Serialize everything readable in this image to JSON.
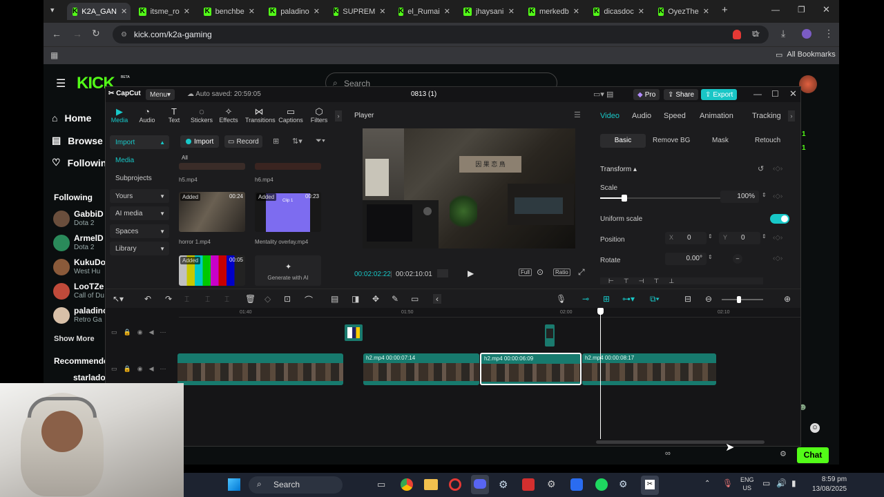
{
  "browser": {
    "tabs": [
      {
        "label": "K2A_GAN",
        "active": true
      },
      {
        "label": "itsme_ro"
      },
      {
        "label": "benchbe"
      },
      {
        "label": "paladino"
      },
      {
        "label": "SUPREM"
      },
      {
        "label": "el_Rumai"
      },
      {
        "label": "jhaysani"
      },
      {
        "label": "merkedb"
      },
      {
        "label": "dicasdoc"
      },
      {
        "label": "OyezThe"
      }
    ],
    "url": "kick.com/k2a-gaming",
    "all_bookmarks": "All Bookmarks"
  },
  "kick": {
    "search_placeholder": "Search",
    "beta": "BETA",
    "nav": [
      {
        "label": "Home"
      },
      {
        "label": "Browse"
      },
      {
        "label": "Following"
      }
    ],
    "following_header": "Following",
    "following": [
      {
        "name": "GabbiD",
        "game": "Dota 2"
      },
      {
        "name": "ArmelD",
        "game": "Dota 2"
      },
      {
        "name": "KukuDo",
        "game": "West Hu"
      },
      {
        "name": "LooTZe",
        "game": "Call of Du"
      },
      {
        "name": "paladino",
        "game": "Retro Ga"
      }
    ],
    "show_more": "Show More",
    "recommended": "Recommended",
    "recommended_first": "starlado",
    "chat_button": "Chat",
    "right_counts": [
      "1",
      "1"
    ]
  },
  "capcut": {
    "logo": "CapCut",
    "menu": "Menu",
    "autosave": "Auto saved: 20:59:05",
    "project": "0813 (1)",
    "pro": "Pro",
    "share": "Share",
    "export": "Export",
    "tools": [
      "Media",
      "Audio",
      "Text",
      "Stickers",
      "Effects",
      "Transitions",
      "Captions",
      "Filters"
    ],
    "media_side": [
      {
        "label": "Import"
      },
      {
        "label": "Media"
      },
      {
        "label": "Subprojects"
      },
      {
        "label": "Yours"
      },
      {
        "label": "AI media"
      },
      {
        "label": "Spaces"
      },
      {
        "label": "Library"
      }
    ],
    "import_btn": "Import",
    "record_btn": "Record",
    "all_label": "All",
    "media_items": [
      {
        "name": "h5.mp4"
      },
      {
        "name": "h6.mp4"
      },
      {
        "name": "horror 1.mp4",
        "badge": "Added",
        "duration": "00:24"
      },
      {
        "name": "Mentality overlay.mp4",
        "badge": "Added",
        "duration": "00:23",
        "overlay_text": "Clip 1"
      },
      {
        "name": "",
        "badge": "Added",
        "duration": "00:05"
      },
      {
        "name": "Generate with AI"
      }
    ],
    "player": {
      "title": "Player",
      "current": "00:02:02:22",
      "total": "00:02:10:01",
      "full": "Full",
      "ratio": "Ratio",
      "sign_text": "因 果 恋 鳥"
    },
    "props": {
      "tabs": [
        "Video",
        "Audio",
        "Speed",
        "Animation",
        "Tracking"
      ],
      "subtabs": [
        "Basic",
        "Remove BG",
        "Mask",
        "Retouch"
      ],
      "transform": "Transform",
      "scale_label": "Scale",
      "scale_value": "100%",
      "scale_fraction": 0.2,
      "uniform_scale": "Uniform scale",
      "position_label": "Position",
      "pos_x_label": "X",
      "pos_x": "0",
      "pos_y_label": "Y",
      "pos_y": "0",
      "rotate_label": "Rotate",
      "rotate_value": "0.00°"
    },
    "timeline": {
      "ticks": [
        "01:40",
        "01:50",
        "02:00",
        "02:10"
      ],
      "clips": [
        {
          "label": ""
        },
        {
          "label": "h2.mp4   00:00:07:14"
        },
        {
          "label": "h2.mp4   00:00:06:09",
          "selected": true
        },
        {
          "label": "h2.mp4   00:00:08:17"
        }
      ]
    }
  },
  "taskbar": {
    "search": "Search",
    "lang": "ENG",
    "region": "US",
    "time": "8:59 pm",
    "date": "13/08/2025"
  }
}
